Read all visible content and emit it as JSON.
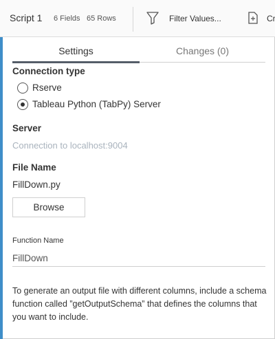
{
  "header": {
    "title": "Script 1",
    "fields": "6 Fields",
    "rows": "65 Rows",
    "filter_label": "Filter Values...",
    "create_label": "Cr"
  },
  "tabs": [
    {
      "label": "Settings",
      "active": true
    },
    {
      "label": "Changes (0)",
      "active": false
    }
  ],
  "connection": {
    "label": "Connection type",
    "options": [
      {
        "label": "Rserve",
        "selected": false
      },
      {
        "label": "Tableau Python (TabPy) Server",
        "selected": true
      }
    ]
  },
  "server": {
    "label": "Server",
    "placeholder": "Connection to localhost:9004"
  },
  "file": {
    "label": "File Name",
    "value": "FillDown.py",
    "browse_label": "Browse"
  },
  "function": {
    "label": "Function Name",
    "value": "FillDown"
  },
  "help_text": "To generate an output file with different columns, include a schema function called ”getOutputSchema” that defines the columns that you want to include.",
  "colors": {
    "accent": "#3f8ec9",
    "tab_active": "#555d68",
    "placeholder": "#a9b3bd"
  }
}
